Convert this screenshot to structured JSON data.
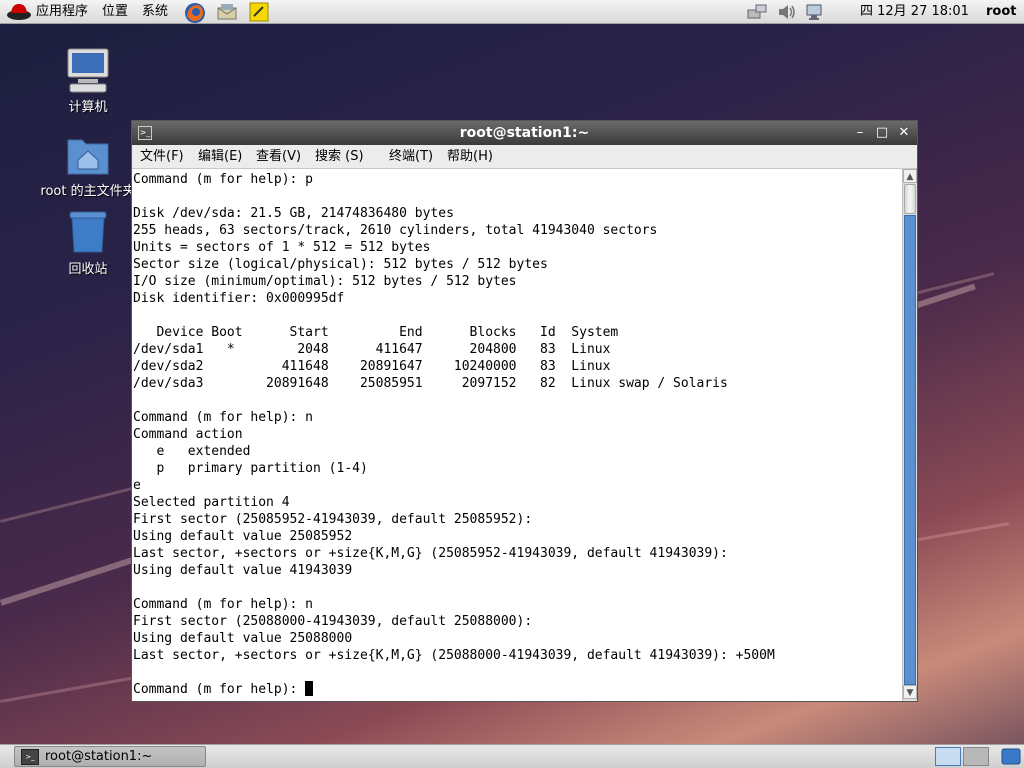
{
  "top_panel": {
    "menu_applications": "应用程序",
    "menu_places": "位置",
    "menu_system": "系统",
    "clock": "四 12月 27 18:01",
    "user": "root"
  },
  "desktop": {
    "icons": [
      {
        "label": "计算机",
        "icon": "computer-icon"
      },
      {
        "label": "root 的主文件夹",
        "icon": "home-folder-icon"
      },
      {
        "label": "回收站",
        "icon": "trash-icon"
      }
    ]
  },
  "window": {
    "title": "root@station1:~",
    "menu": [
      "文件(F)",
      "编辑(E)",
      "查看(V)",
      "搜索 (S)",
      "终端(T)",
      "帮助(H)"
    ],
    "terminal_lines": [
      "Command (m for help): p",
      "",
      "Disk /dev/sda: 21.5 GB, 21474836480 bytes",
      "255 heads, 63 sectors/track, 2610 cylinders, total 41943040 sectors",
      "Units = sectors of 1 * 512 = 512 bytes",
      "Sector size (logical/physical): 512 bytes / 512 bytes",
      "I/O size (minimum/optimal): 512 bytes / 512 bytes",
      "Disk identifier: 0x000995df",
      "",
      "   Device Boot      Start         End      Blocks   Id  System",
      "/dev/sda1   *        2048      411647      204800   83  Linux",
      "/dev/sda2          411648    20891647    10240000   83  Linux",
      "/dev/sda3        20891648    25085951     2097152   82  Linux swap / Solaris",
      "",
      "Command (m for help): n",
      "Command action",
      "   e   extended",
      "   p   primary partition (1-4)",
      "e",
      "Selected partition 4",
      "First sector (25085952-41943039, default 25085952):",
      "Using default value 25085952",
      "Last sector, +sectors or +size{K,M,G} (25085952-41943039, default 41943039):",
      "Using default value 41943039",
      "",
      "Command (m for help): n",
      "First sector (25088000-41943039, default 25088000):",
      "Using default value 25088000",
      "Last sector, +sectors or +size{K,M,G} (25088000-41943039, default 41943039): +500M",
      "",
      "Command (m for help): "
    ]
  },
  "taskbar": {
    "task_label": "root@station1:~"
  }
}
